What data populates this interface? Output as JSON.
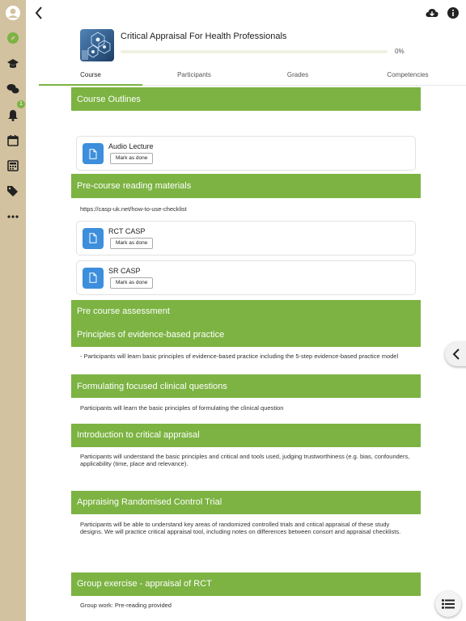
{
  "header": {
    "course_title": "Critical Appraisal For Health Professionals",
    "progress_percent": 0,
    "progress_label": "0%"
  },
  "sidebar": {
    "notification_count": "1",
    "icons": [
      "avatar-icon",
      "site-home-icon",
      "courses-icon",
      "messages-icon",
      "notifications-icon",
      "calendar-icon",
      "grades-icon",
      "tags-icon",
      "more-icon"
    ]
  },
  "tabs": [
    {
      "label": "Course",
      "active": true
    },
    {
      "label": "Participants",
      "active": false
    },
    {
      "label": "Grades",
      "active": false
    },
    {
      "label": "Competencies",
      "active": false
    }
  ],
  "content": {
    "s1_title": "Course Outlines",
    "s1_act1_title": "Audio Lecture",
    "mark_label": "Mark as done",
    "s2_title": "Pre-course reading materials",
    "s2_link": "https://casp-uk.net/how-to-use-checklist",
    "s2_act1_title": "RCT CASP",
    "s2_act2_title": "SR CASP",
    "s3_title": "Pre course assessment",
    "s4_title": "Principles of evidence-based practice",
    "s4_desc": "- Participants will learn basic principles of evidence-based practice including the 5-step evidence-based practice model",
    "s5_title": "Formulating focused clinical questions",
    "s5_desc": "Participants will learn the basic principles of formulating the clinical question",
    "s6_title": "Introduction to critical appraisal",
    "s6_desc": "Participants will understand the basic principles and critical and tools used, judging trustworthiness (e.g. bias, confounders, applicability (time, place and relevance).",
    "s7_title": "Appraising Randomised Control Trial",
    "s7_desc": "Participants will be able to understand key areas of randomized controlled trials and critical appraisal of these study designs. We will practice critical appraisal tool, including notes on differences between consort and appraisal checklists.",
    "s8_title": "Group exercise - appraisal of RCT",
    "s8_desc": "Group work: Pre-reading provided"
  },
  "colors": {
    "accent_green": "#7cb342",
    "sidebar_bg": "#d2c29f",
    "file_icon_blue": "#3d8edc"
  }
}
